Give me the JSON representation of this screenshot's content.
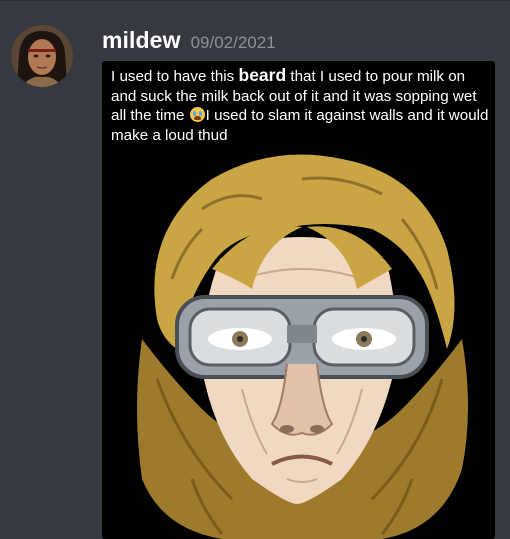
{
  "message": {
    "username": "mildew",
    "timestamp": "09/02/2021",
    "avatar_icon": "user-avatar-photo",
    "caption": {
      "part1": "I used to have this ",
      "highlight": "beard",
      "part2": " that I used to pour milk on and suck the milk back out of it and it was sopping wet all the time ",
      "emoji": "loudly-crying-face-emoji",
      "part3": "I used to slam it against walls and it would make a loud thud"
    },
    "image_icon": "cartoon-face-with-goggles-and-beard"
  },
  "colors": {
    "background": "#36393f",
    "username": "#ffffff",
    "timestamp": "#8e9297",
    "embed_background": "#000000",
    "beard": "#9e7a2c",
    "hair": "#c9a544"
  }
}
